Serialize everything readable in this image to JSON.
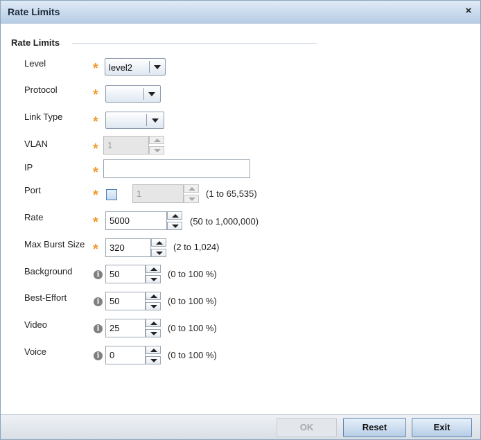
{
  "dialog": {
    "title": "Rate Limits",
    "close_symbol": "×"
  },
  "section": {
    "title": "Rate Limits"
  },
  "fields": {
    "level": {
      "label": "Level",
      "value": "level2"
    },
    "protocol": {
      "label": "Protocol",
      "value": ""
    },
    "link_type": {
      "label": "Link Type",
      "value": ""
    },
    "vlan": {
      "label": "VLAN",
      "value": "1"
    },
    "ip": {
      "label": "IP",
      "value": ""
    },
    "port": {
      "label": "Port",
      "value": "1",
      "range": "(1 to 65,535)"
    },
    "rate": {
      "label": "Rate",
      "value": "5000",
      "range": "(50 to 1,000,000)"
    },
    "max_burst_size": {
      "label": "Max Burst Size",
      "value": "320",
      "range": "(2 to 1,024)"
    },
    "background": {
      "label": "Background",
      "value": "50",
      "range": "(0 to 100 %)"
    },
    "best_effort": {
      "label": "Best-Effort",
      "value": "50",
      "range": "(0 to 100 %)"
    },
    "video": {
      "label": "Video",
      "value": "25",
      "range": "(0 to 100 %)"
    },
    "voice": {
      "label": "Voice",
      "value": "0",
      "range": "(0 to 100 %)"
    }
  },
  "symbols": {
    "required": "*",
    "info": "i"
  },
  "buttons": {
    "ok": "OK",
    "reset": "Reset",
    "exit": "Exit"
  },
  "colors": {
    "required_star": "#f29a2e",
    "header_gradient_top": "#dfeaf6",
    "button_border": "#5c82ad"
  }
}
